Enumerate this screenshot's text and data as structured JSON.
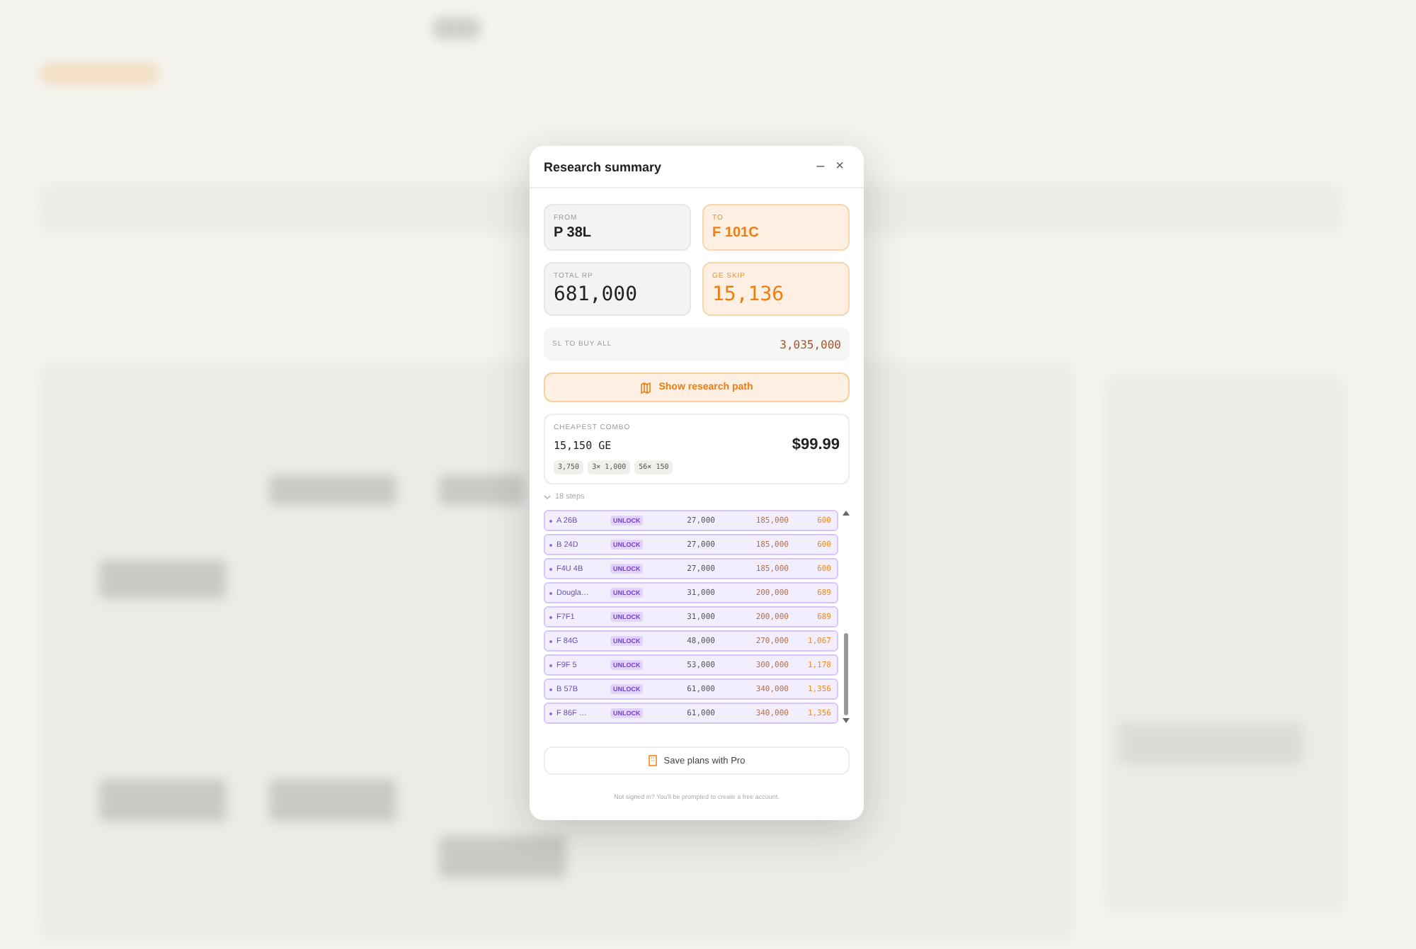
{
  "dialog": {
    "title": "Research summary",
    "minimize": "–",
    "close": "×"
  },
  "from": {
    "label": "FROM",
    "value": "P 38L"
  },
  "to": {
    "label": "TO",
    "value": "F 101C"
  },
  "total_rp": {
    "label": "TOTAL RP",
    "value": "681,000"
  },
  "ge_skip": {
    "label": "GE SKIP",
    "value": "15,136"
  },
  "sl_to_buy": {
    "label": "SL TO BUY ALL",
    "value": "3,035,000"
  },
  "show_path_button": "Show research path",
  "combo": {
    "label": "CHEAPEST COMBO",
    "amount": "15,150 GE",
    "price": "$99.99",
    "packs": [
      "3,750",
      "3× 1,000",
      "56× 150"
    ]
  },
  "steps": {
    "label": "18 steps",
    "expanded": true,
    "rows": [
      {
        "name": "A 26B",
        "badge": "UNLOCK",
        "rp": "27,000",
        "sl": "185,000",
        "ge": "600"
      },
      {
        "name": "B 24D",
        "badge": "UNLOCK",
        "rp": "27,000",
        "sl": "185,000",
        "ge": "600"
      },
      {
        "name": "F4U 4B",
        "badge": "UNLOCK",
        "rp": "27,000",
        "sl": "185,000",
        "ge": "600"
      },
      {
        "name": "Dougla…",
        "badge": "UNLOCK",
        "rp": "31,000",
        "sl": "200,000",
        "ge": "689"
      },
      {
        "name": "F7F1",
        "badge": "UNLOCK",
        "rp": "31,000",
        "sl": "200,000",
        "ge": "689"
      },
      {
        "name": "F 84G",
        "badge": "UNLOCK",
        "rp": "48,000",
        "sl": "270,000",
        "ge": "1,067"
      },
      {
        "name": "F9F 5",
        "badge": "UNLOCK",
        "rp": "53,000",
        "sl": "300,000",
        "ge": "1,178"
      },
      {
        "name": "B 57B",
        "badge": "UNLOCK",
        "rp": "61,000",
        "sl": "340,000",
        "ge": "1,356"
      },
      {
        "name": "F 86F …",
        "badge": "UNLOCK",
        "rp": "61,000",
        "sl": "340,000",
        "ge": "1,356"
      }
    ]
  },
  "save_button": "Save plans with Pro",
  "footnote": "Not signed in? You'll be prompted to create a free account."
}
